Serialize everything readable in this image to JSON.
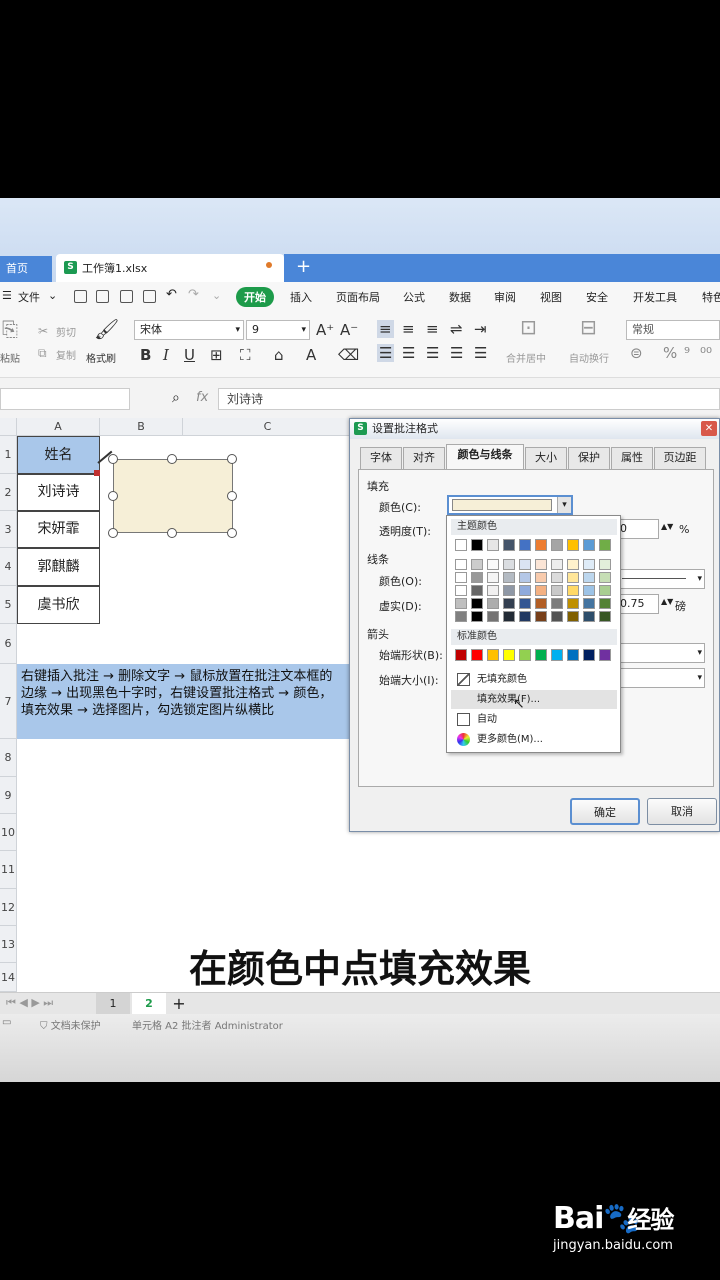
{
  "tabs": {
    "home": "首页",
    "document": "工作簿1.xlsx",
    "add": "+"
  },
  "menu": {
    "file": "文件",
    "items": [
      "开始",
      "插入",
      "页面布局",
      "公式",
      "数据",
      "审阅",
      "视图",
      "安全",
      "开发工具",
      "特色"
    ]
  },
  "ribbon": {
    "cut": "剪切",
    "paste": "粘贴",
    "copy": "复制",
    "format_painter": "格式刷",
    "font_name": "宋体",
    "font_size": "9",
    "merge_center": "合并居中",
    "auto_wrap": "自动换行",
    "number_format": "常规"
  },
  "formula": {
    "fx": "fx",
    "value": "刘诗诗"
  },
  "columns": [
    "A",
    "B",
    "C"
  ],
  "rows": [
    "1",
    "2",
    "3",
    "4",
    "5",
    "6",
    "7",
    "8",
    "9",
    "10",
    "11",
    "12",
    "13",
    "14"
  ],
  "cells": {
    "header": "姓名",
    "names": [
      "刘诗诗",
      "宋妍霏",
      "郭麒麟",
      "虞书欣"
    ]
  },
  "instruction": "右键插入批注 → 删除文字 → 鼠标放置在批注文本框的边缘 → 出现黑色十字时，右键设置批注格式 → 颜色，填充效果 → 选择图片，勾选锁定图片纵横比",
  "dialog": {
    "title": "设置批注格式",
    "tabs": [
      "字体",
      "对齐",
      "颜色与线条",
      "大小",
      "保护",
      "属性",
      "页边距"
    ],
    "fill_section": "填充",
    "color_label": "颜色(C):",
    "transparency_label": "透明度(T):",
    "transparency_value": "0",
    "percent": "%",
    "line_section": "线条",
    "line_color_label": "颜色(O):",
    "dash_label": "虚实(D):",
    "weight_value": "0.75",
    "weight_unit": "磅",
    "arrow_section": "箭头",
    "begin_style_label": "始端形状(B):",
    "begin_size_label": "始端大小(I):",
    "ok": "确定",
    "cancel": "取消"
  },
  "color_popup": {
    "theme_colors": "主题颜色",
    "standard_colors": "标准颜色",
    "no_fill": "无填充颜色",
    "fill_effects": "填充效果(F)...",
    "automatic": "自动",
    "more_colors": "更多颜色(M)...",
    "theme_top": [
      "#ffffff",
      "#000000",
      "#e7e6e6",
      "#44546a",
      "#4472c4",
      "#ed7d31",
      "#a5a5a5",
      "#ffc000",
      "#5b9bd5",
      "#70ad47"
    ],
    "standard": [
      "#c00000",
      "#ff0000",
      "#ffc000",
      "#ffff00",
      "#92d050",
      "#00b050",
      "#00b0f0",
      "#0070c0",
      "#002060",
      "#7030a0"
    ]
  },
  "sheet_tabs": [
    "1",
    "2",
    "+"
  ],
  "status": {
    "protect": "文档未保护",
    "cell_info": "单元格 A2 批注者 Administrator"
  },
  "caption": "在颜色中点填充效果",
  "watermark": {
    "brand": "Bai",
    "brand2": "经验",
    "url": "jingyan.baidu.com"
  }
}
